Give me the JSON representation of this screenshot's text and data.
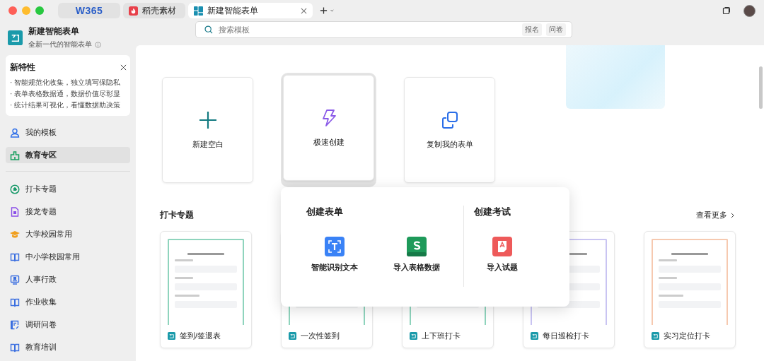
{
  "window_tabs": [
    {
      "label": "W365",
      "kind": "logo",
      "selected": false
    },
    {
      "label": "稻壳素材",
      "kind": "docer",
      "selected": false
    },
    {
      "label": "新建智能表单",
      "kind": "form",
      "selected": true
    }
  ],
  "app": {
    "title": "新建智能表单",
    "subtitle": "全新一代的智能表单"
  },
  "search": {
    "placeholder": "搜索模板",
    "tags": [
      "报名",
      "问卷"
    ]
  },
  "new_features": {
    "title": "新特性",
    "items": [
      "· 智能规范化收集，独立填写保隐私",
      "· 表单表格数据通，数据价值尽彰显",
      "· 统计结果可视化，看懂数据助决策"
    ]
  },
  "sidebar": {
    "top_items": [
      {
        "label": "我的模板",
        "kind": "user",
        "color": "#2f6fe8",
        "selected": false
      },
      {
        "label": "教育专区",
        "kind": "building",
        "color": "#1aa060",
        "selected": true
      }
    ],
    "items": [
      {
        "label": "打卡专题",
        "kind": "clock",
        "color": "#1a9a6a",
        "selected": false
      },
      {
        "label": "接龙专题",
        "kind": "doc",
        "color": "#8a4de8",
        "selected": false
      },
      {
        "label": "大学校园常用",
        "kind": "cap",
        "color": "#f0a020",
        "selected": false
      },
      {
        "label": "中小学校园常用",
        "kind": "book",
        "color": "#3a6ee0",
        "selected": false
      },
      {
        "label": "人事行政",
        "kind": "screen",
        "color": "#3a6ee0",
        "selected": false
      },
      {
        "label": "作业收集",
        "kind": "book",
        "color": "#3a6ee0",
        "selected": false
      },
      {
        "label": "调研问卷",
        "kind": "survey",
        "color": "#3a6ee0",
        "selected": false
      },
      {
        "label": "教育培训",
        "kind": "book",
        "color": "#3a6ee0",
        "selected": false
      }
    ]
  },
  "create_cards": [
    {
      "label": "新建空白",
      "kind": "plus",
      "selected": false
    },
    {
      "label": "极速创建",
      "kind": "bolt",
      "selected": true
    },
    {
      "label": "复制我的表单",
      "kind": "copy",
      "selected": false
    }
  ],
  "popover": {
    "sections": [
      {
        "title": "创建表单",
        "actions": [
          {
            "label": "智能识别文本",
            "kind": "ocr"
          },
          {
            "label": "导入表格数据",
            "kind": "sheet"
          }
        ]
      },
      {
        "title": "创建考试",
        "actions": [
          {
            "label": "导入试题",
            "kind": "exam"
          }
        ]
      }
    ]
  },
  "section": {
    "title": "打卡专题",
    "more": "查看更多"
  },
  "templates": [
    {
      "label": "签到/签退表",
      "color": "#8fd4bd"
    },
    {
      "label": "一次性签到",
      "color": "#8fd4bd"
    },
    {
      "label": "上下班打卡",
      "color": "#8fd4bd"
    },
    {
      "label": "每日巡检打卡",
      "color": "#c9c4f2"
    },
    {
      "label": "实习定位打卡",
      "color": "#f6c9b0"
    }
  ]
}
